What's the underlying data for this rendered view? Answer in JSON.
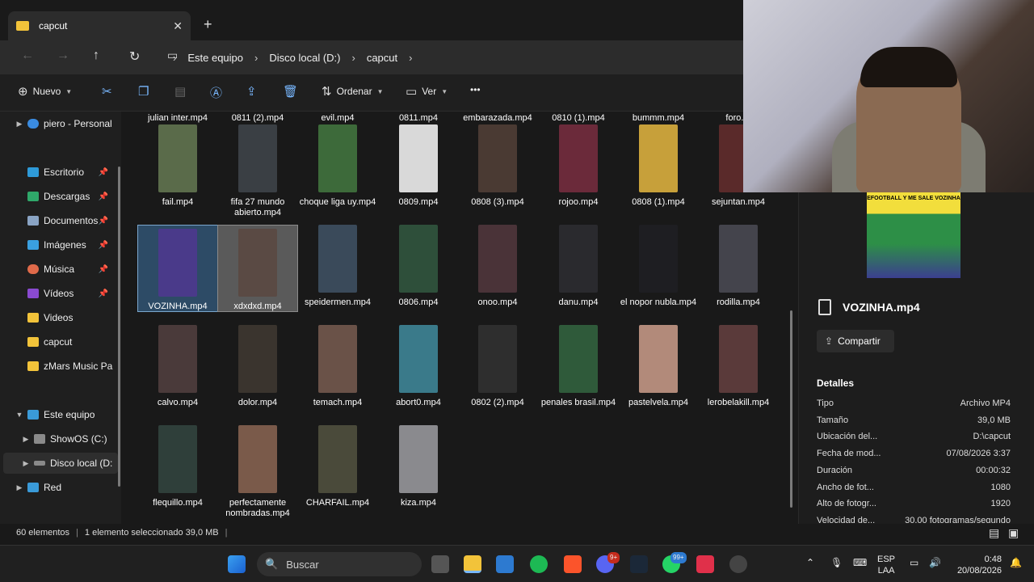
{
  "window": {
    "tab_title": "capcut",
    "new_tab": "+"
  },
  "address": {
    "crumbs": [
      "Este equipo",
      "Disco local (D:)",
      "capcut"
    ]
  },
  "toolbar": {
    "new_label": "Nuevo",
    "sort_label": "Ordenar",
    "view_label": "Ver",
    "more_label": "•••"
  },
  "sidebar": {
    "items": [
      {
        "label": "piero - Personal"
      },
      {
        "label": "Escritorio"
      },
      {
        "label": "Descargas"
      },
      {
        "label": "Documentos"
      },
      {
        "label": "Imágenes"
      },
      {
        "label": "Música"
      },
      {
        "label": "Vídeos"
      },
      {
        "label": "Videos"
      },
      {
        "label": "capcut"
      },
      {
        "label": "zMars Music Pa"
      },
      {
        "label": "Este equipo"
      },
      {
        "label": "ShowOS (C:)"
      },
      {
        "label": "Disco local (D:"
      },
      {
        "label": "Red"
      }
    ]
  },
  "files": {
    "row0": [
      "julian inter.mp4",
      "0811 (2).mp4",
      "evil.mp4",
      "0811.mp4",
      "embarazada.mp4",
      "0810 (1).mp4",
      "bummm.mp4",
      "foro.m"
    ],
    "items": [
      {
        "name": "fail.mp4",
        "color": "#5a6b4a"
      },
      {
        "name": "fifa 27 mundo abierto.mp4",
        "color": "#3a3f44"
      },
      {
        "name": "choque liga uy.mp4",
        "color": "#3d6a3a"
      },
      {
        "name": "0809.mp4",
        "color": "#d9d9d9"
      },
      {
        "name": "0808 (3).mp4",
        "color": "#4a3a33"
      },
      {
        "name": "rojoo.mp4",
        "color": "#6b2a3a"
      },
      {
        "name": "0808 (1).mp4",
        "color": "#c7a03a"
      },
      {
        "name": "sejuntan.mp4",
        "color": "#5a2a2a"
      },
      {
        "name": "VOZINHA.mp4",
        "color": "#4a3a8a"
      },
      {
        "name": "xdxdxd.mp4",
        "color": "#5a4a44"
      },
      {
        "name": "speidermen.mp4",
        "color": "#3a4a5a"
      },
      {
        "name": "0806.mp4",
        "color": "#2e4f3a"
      },
      {
        "name": "onoo.mp4",
        "color": "#4a3338"
      },
      {
        "name": "danu.mp4",
        "color": "#2a2a2e"
      },
      {
        "name": "el nopor nubla.mp4",
        "color": "#1e1e22"
      },
      {
        "name": "rodilla.mp4",
        "color": "#44444c"
      },
      {
        "name": "calvo.mp4",
        "color": "#4a3a3a"
      },
      {
        "name": "dolor.mp4",
        "color": "#3a342e"
      },
      {
        "name": "temach.mp4",
        "color": "#6a5248"
      },
      {
        "name": "abort0.mp4",
        "color": "#3a7a8a"
      },
      {
        "name": "0802 (2).mp4",
        "color": "#2e2e2e"
      },
      {
        "name": "penales brasil.mp4",
        "color": "#2f5a3a"
      },
      {
        "name": "pastelvela.mp4",
        "color": "#b28a7a"
      },
      {
        "name": "lerobelakill.mp4",
        "color": "#5a3a3a"
      },
      {
        "name": "flequillo.mp4",
        "color": "#2f3f3a"
      },
      {
        "name": "perfectamente nombradas.mp4",
        "color": "#7a5a4a"
      },
      {
        "name": "CHARFAIL.mp4",
        "color": "#4a4a3a"
      },
      {
        "name": "kiza.mp4",
        "color": "#8a8a8e"
      }
    ]
  },
  "details": {
    "preview_text": "EFOOTBALL Y ME SALE VOZINHA",
    "title": "VOZINHA.mp4",
    "share_label": "Compartir",
    "section": "Detalles",
    "rows": [
      {
        "k": "Tipo",
        "v": "Archivo MP4"
      },
      {
        "k": "Tamaño",
        "v": "39,0 MB"
      },
      {
        "k": "Ubicación del...",
        "v": "D:\\capcut"
      },
      {
        "k": "Fecha de mod...",
        "v": "07/08/2026 3:37"
      },
      {
        "k": "Duración",
        "v": "00:00:32"
      },
      {
        "k": "Ancho de fot...",
        "v": "1080"
      },
      {
        "k": "Alto de fotogr...",
        "v": "1920"
      },
      {
        "k": "Velocidad de...",
        "v": "30,00 fotogramas/segundo"
      }
    ]
  },
  "status": {
    "count": "60 elementos",
    "selected": "1 elemento seleccionado  39,0 MB"
  },
  "taskbar": {
    "search_placeholder": "Buscar",
    "lang1": "ESP",
    "lang2": "LAA",
    "time": "0:48",
    "date": "20/08/2026",
    "discord_badge": "9+",
    "whatsapp_badge": "99+"
  }
}
